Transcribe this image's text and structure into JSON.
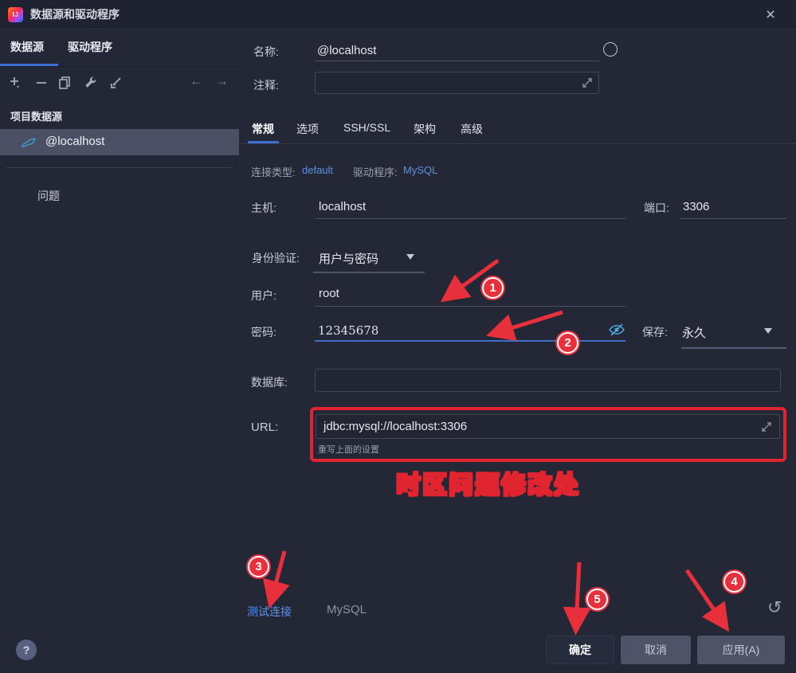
{
  "titlebar": {
    "app_icon": "IJ",
    "title": "数据源和驱动程序",
    "close": "×"
  },
  "sidebar": {
    "tabs": [
      "数据源",
      "驱动程序"
    ],
    "nav": {
      "back": "←",
      "forward": "→"
    },
    "section": "项目数据源",
    "datasource": "@localhost",
    "issues": "问题",
    "help": "?"
  },
  "form": {
    "name_label": "名称:",
    "name_value": "@localhost",
    "comment_label": "注释:",
    "comment_value": "",
    "tabs": [
      "常规",
      "选项",
      "SSH/SSL",
      "架构",
      "高级"
    ],
    "connection_type_label": "连接类型:",
    "connection_type_value": "default",
    "driver_label": "驱动程序:",
    "driver_value": "MySQL",
    "host_label": "主机:",
    "host_value": "localhost",
    "port_label": "端口:",
    "port_value": "3306",
    "auth_label": "身份验证:",
    "auth_value": "用户与密码",
    "user_label": "用户:",
    "user_value": "root",
    "password_label": "密码:",
    "password_value": "12345678",
    "save_label": "保存:",
    "save_value": "永久",
    "database_label": "数据库:",
    "database_value": "",
    "url_label": "URL:",
    "url_value": "jdbc:mysql://localhost:3306",
    "url_hint": "重写上面的设置",
    "test_connection": "测试连接",
    "dialect": "MySQL"
  },
  "buttons": {
    "ok": "确定",
    "cancel": "取消",
    "apply": "应用(A)"
  },
  "annotations": {
    "caption": "时区问题修改处",
    "badges": [
      "1",
      "2",
      "3",
      "4",
      "5"
    ],
    "undo": "↺"
  },
  "colors": {
    "accent_blue": "#3c6ed6",
    "link_blue": "#5d90e8",
    "annotation_red": "#e8303c",
    "selection_bg": "#4a5164",
    "background": "#242836"
  }
}
